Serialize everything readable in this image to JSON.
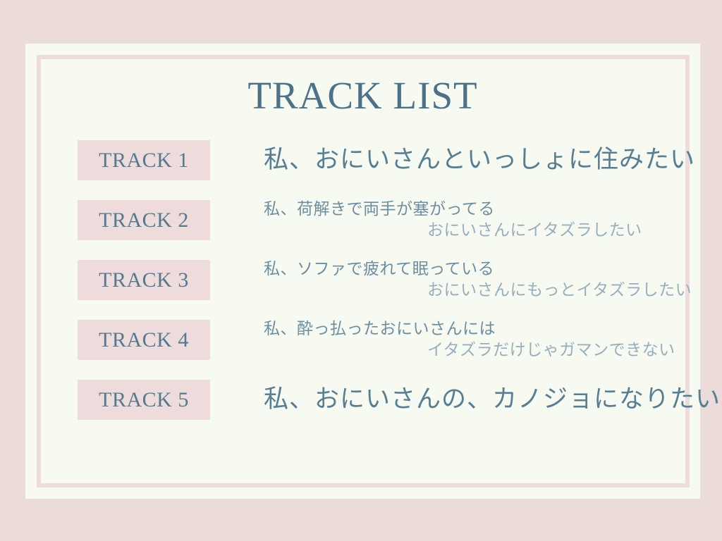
{
  "slide": {
    "title": "TRACK LIST",
    "colors": {
      "outer_mat": "#ebdcda",
      "card": "#f7faf1",
      "inner_rule": "#eddcdb",
      "badge_fill": "#eddcdb",
      "title_text": "#4c7189",
      "badge_text": "#55798f",
      "feature_text": "#587e94",
      "line_main_text": "#6b8ea2",
      "line_sub_text": "#96afbe"
    }
  },
  "tracks": [
    {
      "badge": "TRACK 1",
      "layout": "single",
      "line_main": "私、おにいさんといっしょに住みたい",
      "line_sub": ""
    },
    {
      "badge": "TRACK 2",
      "layout": "double",
      "line_main": "私、荷解きで両手が塞がってる",
      "line_sub": "おにいさんにイタズラしたい"
    },
    {
      "badge": "TRACK 3",
      "layout": "double",
      "line_main": "私、ソファで疲れて眠っている",
      "line_sub": "おにいさんにもっとイタズラしたい"
    },
    {
      "badge": "TRACK 4",
      "layout": "double",
      "line_main": "私、酔っ払ったおにいさんには",
      "line_sub": "イタズラだけじゃガマンできない"
    },
    {
      "badge": "TRACK 5",
      "layout": "single",
      "line_main": "私、おにいさんの、カノジョになりたい",
      "line_sub": ""
    }
  ]
}
